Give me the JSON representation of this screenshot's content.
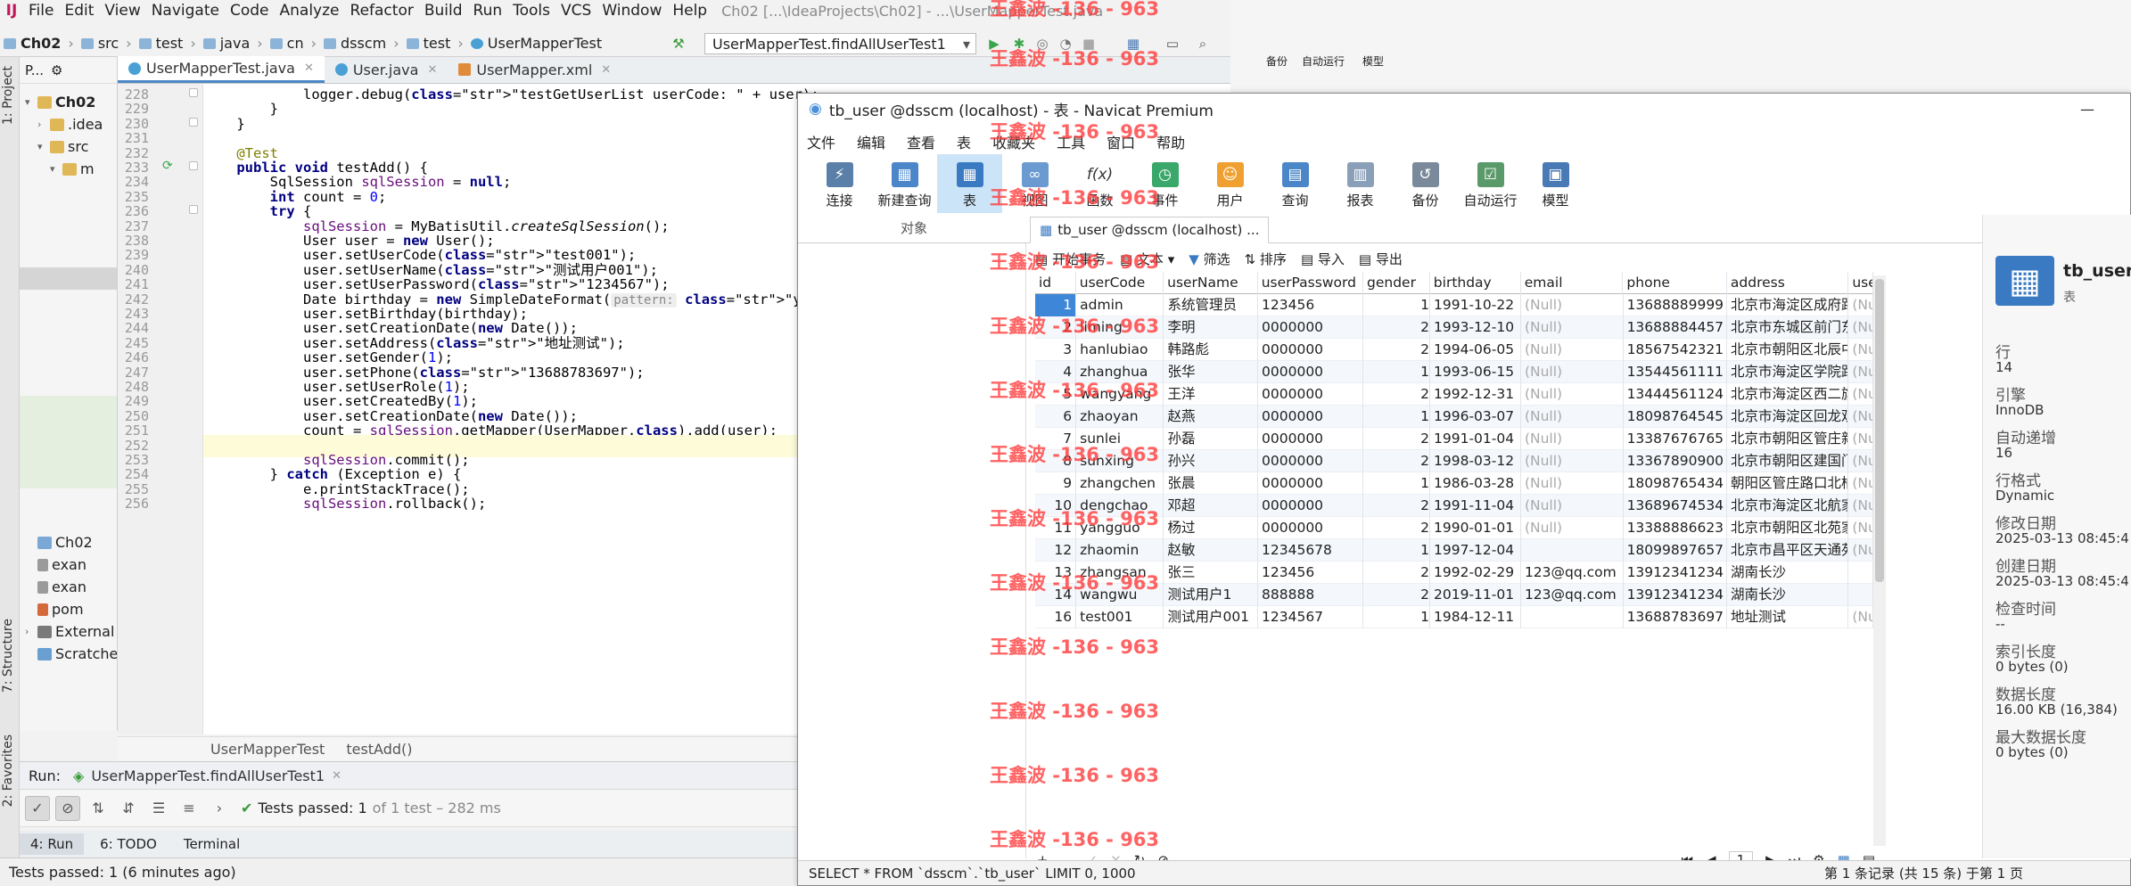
{
  "idea": {
    "menu": [
      "File",
      "Edit",
      "View",
      "Navigate",
      "Code",
      "Analyze",
      "Refactor",
      "Build",
      "Run",
      "Tools",
      "VCS",
      "Window",
      "Help"
    ],
    "window_title": "Ch02 [...\\IdeaProjects\\Ch02] - ...\\UserMapperTest.java",
    "breadcrumb": [
      "Ch02",
      "src",
      "test",
      "java",
      "cn",
      "dsscm",
      "test",
      "UserMapperTest"
    ],
    "run_config": "UserMapperTest.findAllUserTest1",
    "project_panel_label": "P...",
    "tree": [
      {
        "label": "Ch02",
        "level": 0
      },
      {
        "label": ".idea",
        "level": 1
      },
      {
        "label": "src",
        "level": 1
      },
      {
        "label": "m",
        "level": 2
      },
      {
        "label": "Ch02",
        "level": 2
      },
      {
        "label": "exan",
        "level": 2
      },
      {
        "label": "exan",
        "level": 2
      },
      {
        "label": "pom",
        "level": 2
      },
      {
        "label": "External",
        "level": 0
      },
      {
        "label": "Scratche",
        "level": 0
      }
    ],
    "tabs": [
      "UserMapperTest.java",
      "User.java",
      "UserMapper.xml"
    ],
    "line_numbers": [
      228,
      229,
      230,
      231,
      232,
      233,
      234,
      235,
      236,
      237,
      238,
      239,
      240,
      241,
      242,
      243,
      244,
      245,
      246,
      247,
      248,
      249,
      250,
      251,
      252,
      253,
      254,
      255,
      256
    ],
    "code_lines": [
      "            logger.debug(\"testGetUserList userCode: \" + user);",
      "        }",
      "    }",
      "",
      "    @Test",
      "    public void testAdd() {",
      "        SqlSession sqlSession = null;",
      "        int count = 0;",
      "        try {",
      "            sqlSession = MyBatisUtil.createSqlSession();",
      "            User user = new User();",
      "            user.setUserCode(\"test001\");",
      "            user.setUserName(\"测试用户001\");",
      "            user.setUserPassword(\"1234567\");",
      "            Date birthday = new SimpleDateFormat( pattern: \"yyyy-MM-dd\").par",
      "            user.setBirthday(birthday);",
      "            user.setCreationDate(new Date());",
      "            user.setAddress(\"地址测试\");",
      "            user.setGender(1);",
      "            user.setPhone(\"13688783697\");",
      "            user.setUserRole(1);",
      "            user.setCreatedBy(1);",
      "            user.setCreationDate(new Date());",
      "            count = sqlSession.getMapper(UserMapper.class).add(user);",
      "",
      "            sqlSession.commit();",
      "        } catch (Exception e) {",
      "            e.printStackTrace();",
      "            sqlSession.rollback();"
    ],
    "editor_breadcrumb": [
      "UserMapperTest",
      "testAdd()"
    ],
    "run_label": "Run:",
    "run_tab": "UserMapperTest.findAllUserTest1",
    "test_result": "Tests passed: 1",
    "test_detail": "of 1 test – 282 ms",
    "bottom_tabs": [
      "4: Run",
      "6: TODO",
      "Terminal"
    ],
    "status": "Tests passed: 1 (6 minutes ago)",
    "left_strip": [
      "1: Project",
      "7: Structure",
      "2: Favorites"
    ]
  },
  "navicat": {
    "title": "tb_user @dsscm (localhost) - 表 - Navicat Premium",
    "menu": [
      "文件",
      "编辑",
      "查看",
      "表",
      "收藏夹",
      "工具",
      "窗口",
      "帮助"
    ],
    "toolbar": [
      "连接",
      "新建查询",
      "表",
      "视图",
      "函数",
      "事件",
      "用户",
      "查询",
      "报表",
      "备份",
      "自动运行",
      "模型"
    ],
    "object_tab": "对象",
    "table_tab": "tb_user @dsscm (localhost) ...",
    "grid_tools": [
      "开始事务",
      "文本",
      "筛选",
      "排序",
      "导入",
      "导出"
    ],
    "columns": [
      "id",
      "userCode",
      "userName",
      "userPassword",
      "gender",
      "birthday",
      "email",
      "phone",
      "address",
      "use"
    ],
    "rows": [
      [
        "1",
        "admin",
        "系统管理员",
        "123456",
        "1",
        "1991-10-22",
        "(Null)",
        "13688889999",
        "北京市海淀区成府路2(",
        "(Nu"
      ],
      [
        "2",
        "liming",
        "李明",
        "0000000",
        "2",
        "1993-12-10",
        "(Null)",
        "13688884457",
        "北京市东城区前门东大",
        "(Nu"
      ],
      [
        "3",
        "hanlubiao",
        "韩路彪",
        "0000000",
        "2",
        "1994-06-05",
        "(Null)",
        "18567542321",
        "北京市朝阳区北辰中心",
        "(Nu"
      ],
      [
        "4",
        "zhanghua",
        "张华",
        "0000000",
        "1",
        "1993-06-15",
        "(Null)",
        "13544561111",
        "北京市海淀区学院路6",
        "(Nu"
      ],
      [
        "5",
        "wangyang",
        "王洋",
        "0000000",
        "2",
        "1992-12-31",
        "(Null)",
        "13444561124",
        "北京市海淀区西二旗辉",
        "(Nu"
      ],
      [
        "6",
        "zhaoyan",
        "赵燕",
        "0000000",
        "1",
        "1996-03-07",
        "(Null)",
        "18098764545",
        "北京市海淀区回龙观小",
        "(Nu"
      ],
      [
        "7",
        "sunlei",
        "孙磊",
        "0000000",
        "2",
        "1991-01-04",
        "(Null)",
        "13387676765",
        "北京市朝阳区管庄新月",
        "(Nu"
      ],
      [
        "8",
        "sunxing",
        "孙兴",
        "0000000",
        "2",
        "1998-03-12",
        "(Null)",
        "13367890900",
        "北京市朝阳区建国门南",
        "(Nu"
      ],
      [
        "9",
        "zhangchen",
        "张晨",
        "0000000",
        "1",
        "1986-03-28",
        "(Null)",
        "18098765434",
        "朝阳区管庄路口北柏林",
        "(Nu"
      ],
      [
        "10",
        "dengchao",
        "邓超",
        "0000000",
        "2",
        "1991-11-04",
        "(Null)",
        "13689674534",
        "北京市海淀区北航家属",
        "(Nu"
      ],
      [
        "11",
        "yangguo",
        "杨过",
        "0000000",
        "2",
        "1990-01-01",
        "(Null)",
        "13388886623",
        "北京市朝阳区北苑家园",
        "(Nu"
      ],
      [
        "12",
        "zhaomin",
        "赵敏",
        "12345678",
        "1",
        "1997-12-04",
        "",
        "18099897657",
        "北京市昌平区天通苑3[",
        "(Nu"
      ],
      [
        "13",
        "zhangsan",
        "张三",
        "123456",
        "2",
        "1992-02-29",
        "123@qq.com",
        "13912341234",
        "湖南长沙",
        ""
      ],
      [
        "14",
        "wangwu",
        "测试用户1",
        "888888",
        "2",
        "2019-11-01",
        "123@qq.com",
        "13912341234",
        "湖南长沙",
        ""
      ],
      [
        "16",
        "test001",
        "测试用户001",
        "1234567",
        "1",
        "1984-12-11",
        "",
        "13688783697",
        "地址测试",
        "(Nu"
      ]
    ],
    "page": "1",
    "sql": "SELECT * FROM `dsscm`.`tb_user` LIMIT 0, 1000",
    "record_info": "第 1 条记录 (共 15 条) 于第 1 页",
    "info": {
      "name": "tb_user",
      "type": "表",
      "fields": [
        {
          "label": "行",
          "value": "14"
        },
        {
          "label": "引擎",
          "value": "InnoDB"
        },
        {
          "label": "自动递增",
          "value": "16"
        },
        {
          "label": "行格式",
          "value": "Dynamic"
        },
        {
          "label": "修改日期",
          "value": "2025-03-13 08:45:4"
        },
        {
          "label": "创建日期",
          "value": "2025-03-13 08:45:4"
        },
        {
          "label": "检查时间",
          "value": "--"
        },
        {
          "label": "索引长度",
          "value": "0 bytes (0)"
        },
        {
          "label": "数据长度",
          "value": "16.00 KB (16,384)"
        },
        {
          "label": "最大数据长度",
          "value": "0 bytes (0)"
        }
      ]
    }
  },
  "background_window": {
    "labels": [
      "备份",
      "自动运行",
      "模型"
    ]
  },
  "watermark": "王鑫波 -136 - 963"
}
